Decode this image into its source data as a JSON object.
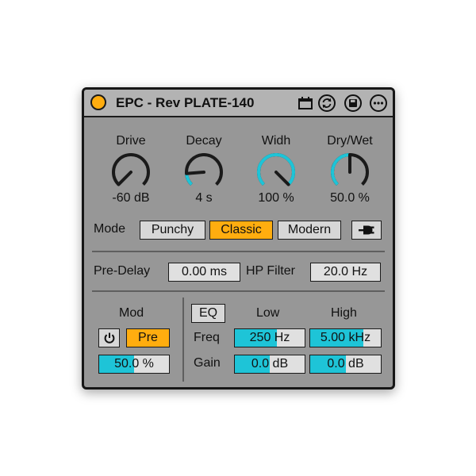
{
  "device": {
    "title": "EPC - Rev PLATE-140",
    "colors": {
      "accent": "#ffad0f",
      "arc": "#1ec4d7",
      "panel": "#979797",
      "titlebar": "#b3b3b3"
    },
    "title_icons": [
      "calendar-icon",
      "refresh-icon",
      "save-icon",
      "more-icon"
    ]
  },
  "knobs": [
    {
      "label": "Drive",
      "value": "-60 dB",
      "fraction": 0.0
    },
    {
      "label": "Decay",
      "value": "4 s",
      "fraction": 0.15
    },
    {
      "label": "Widh",
      "value": "100 %",
      "fraction": 1.0
    },
    {
      "label": "Dry/Wet",
      "value": "50.0 %",
      "fraction": 0.5
    }
  ],
  "mode": {
    "label": "Mode",
    "options": [
      "Punchy",
      "Classic",
      "Modern"
    ],
    "selected": "Classic",
    "plug_icon": "plug-icon"
  },
  "predelay": {
    "label": "Pre-Delay",
    "value": "0.00 ms"
  },
  "hpfilter": {
    "label": "HP Filter",
    "value": "20.0 Hz"
  },
  "mod": {
    "label": "Mod",
    "power_icon": "power-icon",
    "pre_label": "Pre",
    "amount": "50.0 %",
    "amount_fraction": 0.5
  },
  "eq": {
    "button_label": "EQ",
    "low_label": "Low",
    "high_label": "High",
    "freq_label": "Freq",
    "gain_label": "Gain",
    "low_freq": "250 Hz",
    "low_freq_fraction": 0.6,
    "high_freq": "5.00 kHz",
    "high_freq_fraction": 0.75,
    "low_gain": "0.0 dB",
    "low_gain_fraction": 0.5,
    "high_gain": "0.0 dB",
    "high_gain_fraction": 0.5
  }
}
